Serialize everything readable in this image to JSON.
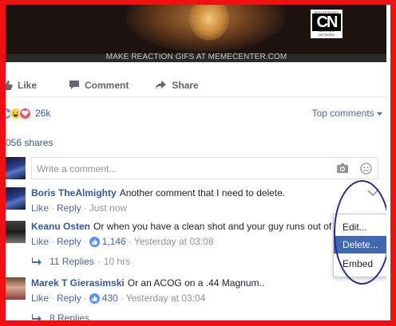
{
  "video": {
    "caption": "MAKE REACTION GIFS AT MEMECENTER.COM",
    "logo_text": "CN",
    "logo_top_text": "NEW EPISODES",
    "logo_bottom_text": "CARTOON NETWORK"
  },
  "actions": {
    "like": "Like",
    "comment": "Comment",
    "share": "Share"
  },
  "reactions": {
    "count": "26k",
    "sort_label": "Top comments"
  },
  "shares": "056 shares",
  "comment_box": {
    "placeholder": "Write a comment..."
  },
  "comments": [
    {
      "author": "Boris TheAlmighty",
      "text": "Another comment that I need to delete.",
      "like": "Like",
      "reply": "Reply",
      "time": "Just now"
    },
    {
      "author": "Keanu Osten",
      "text": "Or when you have a clean shot and your guy runs out of",
      "like": "Like",
      "reply": "Reply",
      "likes": "1,146",
      "time": "Yesterday at 03:08",
      "replies": "11 Replies",
      "replies_time": "10 hrs"
    },
    {
      "author": "Marek T Gierasimski",
      "text": "Or an ACOG on a .44 Magnum..",
      "like": "Like",
      "reply": "Reply",
      "likes": "430",
      "time": "Yesterday at 03:04",
      "replies": "8 Replies"
    }
  ],
  "menu": {
    "items": [
      "Edit...",
      "Delete...",
      "Embed"
    ],
    "selected": "Delete..."
  },
  "colors": {
    "frame": "#ee1111",
    "link": "#385898",
    "menu_highlight": "#4267b2",
    "annotation_oval": "#2a2c8c"
  }
}
